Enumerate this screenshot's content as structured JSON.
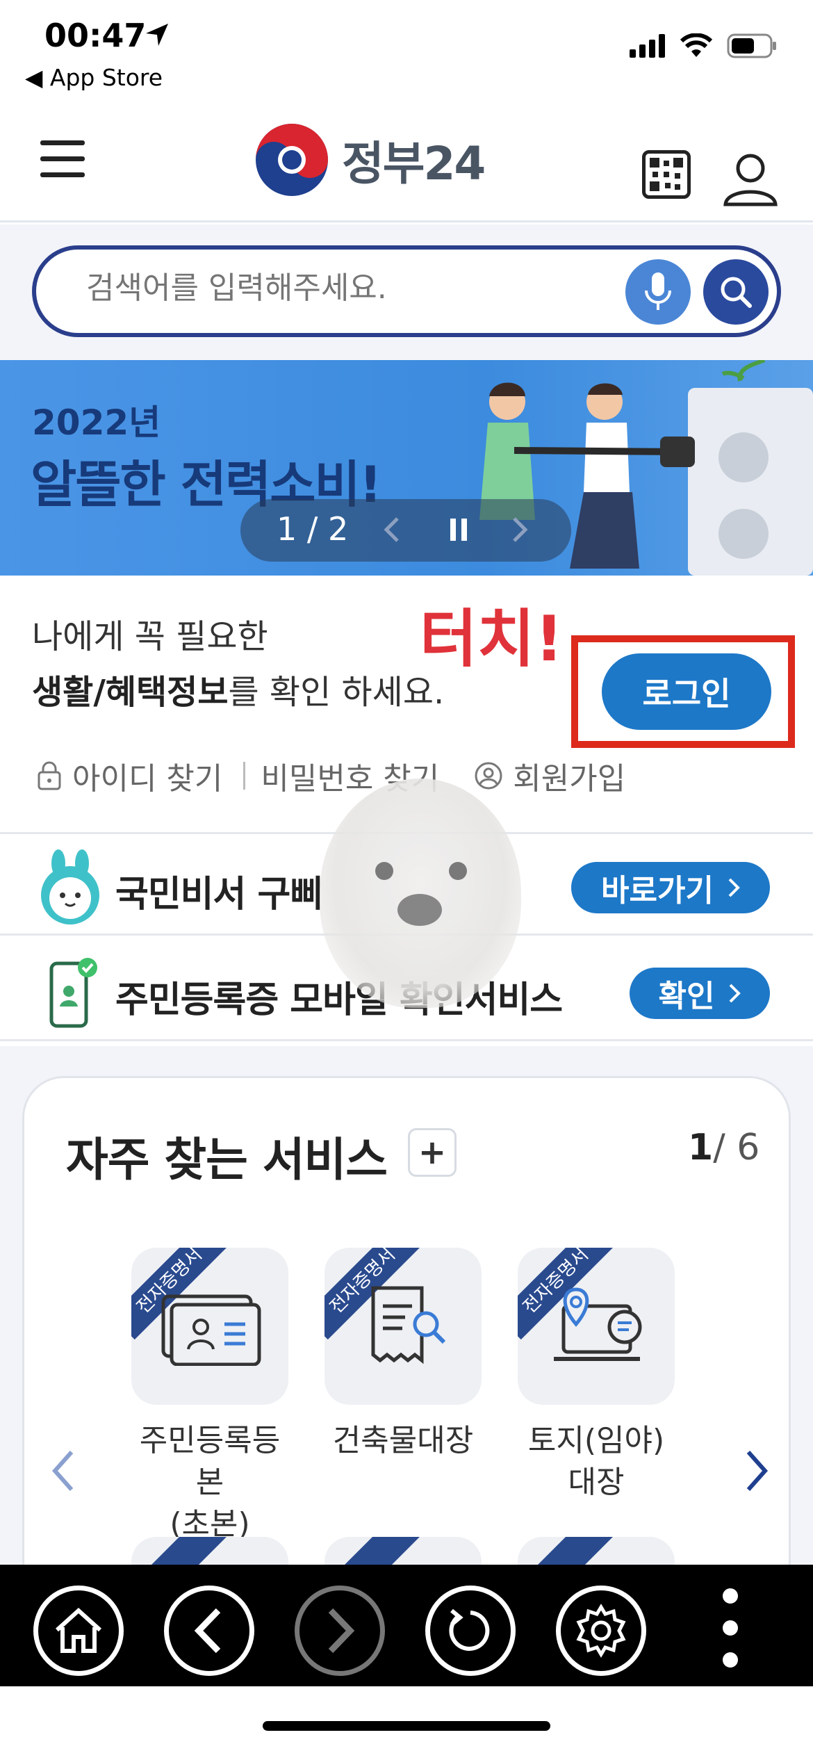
{
  "status_bar": {
    "time": "00:47",
    "back_label": "◀ App Store"
  },
  "header": {
    "logo_text": "정부24"
  },
  "search": {
    "placeholder": "검색어를 입력해주세요."
  },
  "banner": {
    "year": "2022년",
    "headline": "알뜰한 전력소비!",
    "pager": "1 / 2"
  },
  "login_section": {
    "line1": "나에게 꼭 필요한",
    "line2_bold": "생활/혜택정보",
    "line2_rest": "를 확인 하세요.",
    "touch_annotation": "터치!",
    "login_button": "로그인",
    "links": [
      "아이디 찾기",
      "비밀번호 찾기",
      "회원가입"
    ]
  },
  "rows": [
    {
      "label": "국민비서 구삐",
      "button": "바로가기"
    },
    {
      "label": "주민등록증 모바일 확인서비스",
      "button": "확인"
    }
  ],
  "services": {
    "title": "자주 찾는 서비스",
    "plus": "+",
    "page_current": "1",
    "page_total": "/ 6",
    "items": [
      {
        "tag": "전자증명서",
        "label": "주민등록등본\n(초본)"
      },
      {
        "tag": "전자증명서",
        "label": "건축물대장"
      },
      {
        "tag": "전자증명서",
        "label": "토지(임야)\n대장"
      }
    ]
  },
  "colors": {
    "primary": "#1d78c8",
    "navy": "#2a3e8c",
    "annotation_red": "#dc2a1c"
  }
}
